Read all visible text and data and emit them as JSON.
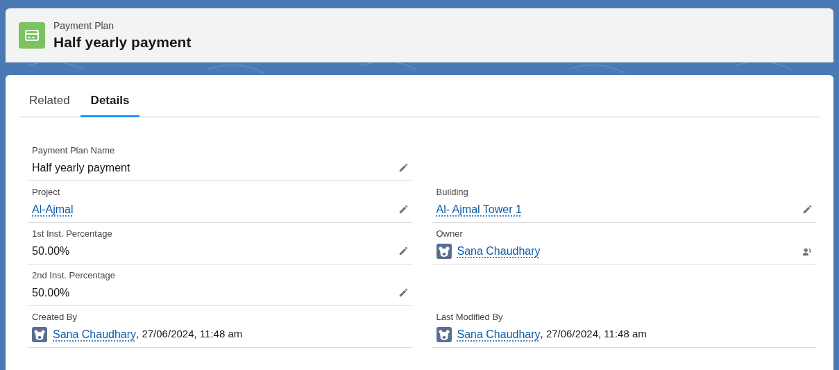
{
  "header": {
    "object_type": "Payment Plan",
    "title": "Half yearly payment"
  },
  "tabs": [
    {
      "label": "Related",
      "selected": false
    },
    {
      "label": "Details",
      "selected": true
    }
  ],
  "rows": [
    {
      "left": {
        "label": "Payment Plan Name",
        "kind": "text",
        "value": "Half yearly payment",
        "action": {
          "kind": "edit"
        }
      }
    },
    {
      "left": {
        "label": "Project",
        "kind": "link",
        "value": "Al-Ajmal",
        "action": {
          "kind": "edit"
        }
      },
      "right": {
        "label": "Building",
        "kind": "link",
        "value": "Al- Ajmal Tower 1",
        "action": {
          "kind": "edit"
        }
      }
    },
    {
      "left": {
        "label": "1st Inst. Percentage",
        "kind": "text",
        "value": "50.00%",
        "action": {
          "kind": "edit"
        }
      },
      "right": {
        "label": "Owner",
        "kind": "user",
        "value": "Sana Chaudhary",
        "action": {
          "kind": "change-owner"
        }
      }
    },
    {
      "left": {
        "label": "2nd Inst. Percentage",
        "kind": "text",
        "value": "50.00%",
        "action": {
          "kind": "edit"
        }
      }
    },
    {
      "left": {
        "label": "Created By",
        "kind": "user",
        "value": "Sana Chaudhary",
        "suffix": ", 27/06/2024, 11:48 am"
      },
      "right": {
        "label": "Last Modified By",
        "kind": "user",
        "value": "Sana Chaudhary",
        "suffix": ", 27/06/2024, 11:48 am"
      }
    }
  ]
}
